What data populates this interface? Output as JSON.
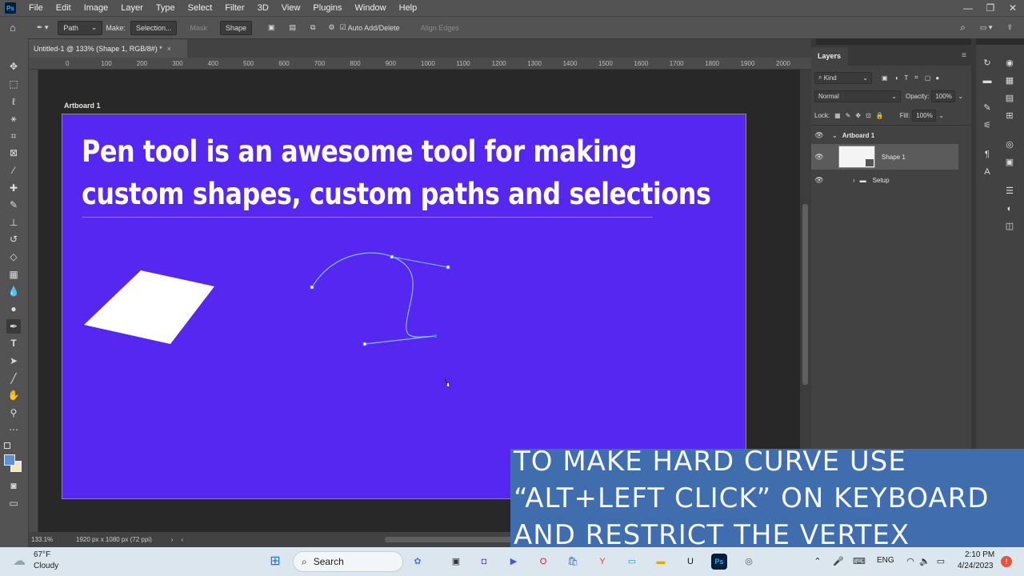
{
  "menubar": {
    "logo": "Ps",
    "items": [
      "File",
      "Edit",
      "Image",
      "Layer",
      "Type",
      "Select",
      "Filter",
      "3D",
      "View",
      "Plugins",
      "Window",
      "Help"
    ],
    "window_controls": [
      "—",
      "❐",
      "✕"
    ]
  },
  "options_bar": {
    "mode_select": "Path",
    "make_label": "Make:",
    "selection_btn": "Selection...",
    "mask_btn": "Mask",
    "shape_btn": "Shape",
    "auto_add_delete": "Auto Add/Delete",
    "align_edges": "Align Edges"
  },
  "document_tab": {
    "title": "Untitled-1 @ 133% (Shape 1, RGB/8#) *",
    "close": "×"
  },
  "ruler": {
    "ticks": [
      "0",
      "100",
      "200",
      "300",
      "400",
      "500",
      "600",
      "700",
      "800",
      "900",
      "1000",
      "1100",
      "1200",
      "1300",
      "1400",
      "1500",
      "1600",
      "1700",
      "1800",
      "1900",
      "2000"
    ]
  },
  "canvas": {
    "artboard_label": "Artboard 1",
    "headline_line1": "Pen tool is an awesome tool for making",
    "headline_line2": "custom shapes, custom paths and selections",
    "artboard_color": "#5527f0"
  },
  "status_bar": {
    "zoom": "133.1%",
    "doc_size": "1920 px x 1080 px (72 ppi)",
    "arrow": "›"
  },
  "layers_panel": {
    "tab_label": "Layers",
    "filter_kind": "Kind",
    "blend_mode": "Normal",
    "opacity_label": "Opacity:",
    "opacity_value": "100%",
    "lock_label": "Lock:",
    "fill_label": "Fill:",
    "fill_value": "100%",
    "layers": [
      {
        "name": "Artboard 1",
        "type": "artboard"
      },
      {
        "name": "Shape 1",
        "type": "shape"
      },
      {
        "name": "Setup",
        "type": "group"
      }
    ]
  },
  "caption": {
    "line1": "TO MAKE HARD CURVE  USE",
    "line2": "“ALT+LEFT CLICK” ON KEYBOARD",
    "line3": "AND RESTRICT THE VERTEX",
    "bg_color": "#3f6dae"
  },
  "taskbar": {
    "weather_temp": "67°F",
    "weather_desc": "Cloudy",
    "search_label": "Search",
    "language": "ENG",
    "time": "2:10 PM",
    "date": "4/24/2023",
    "notification_count": "!"
  }
}
